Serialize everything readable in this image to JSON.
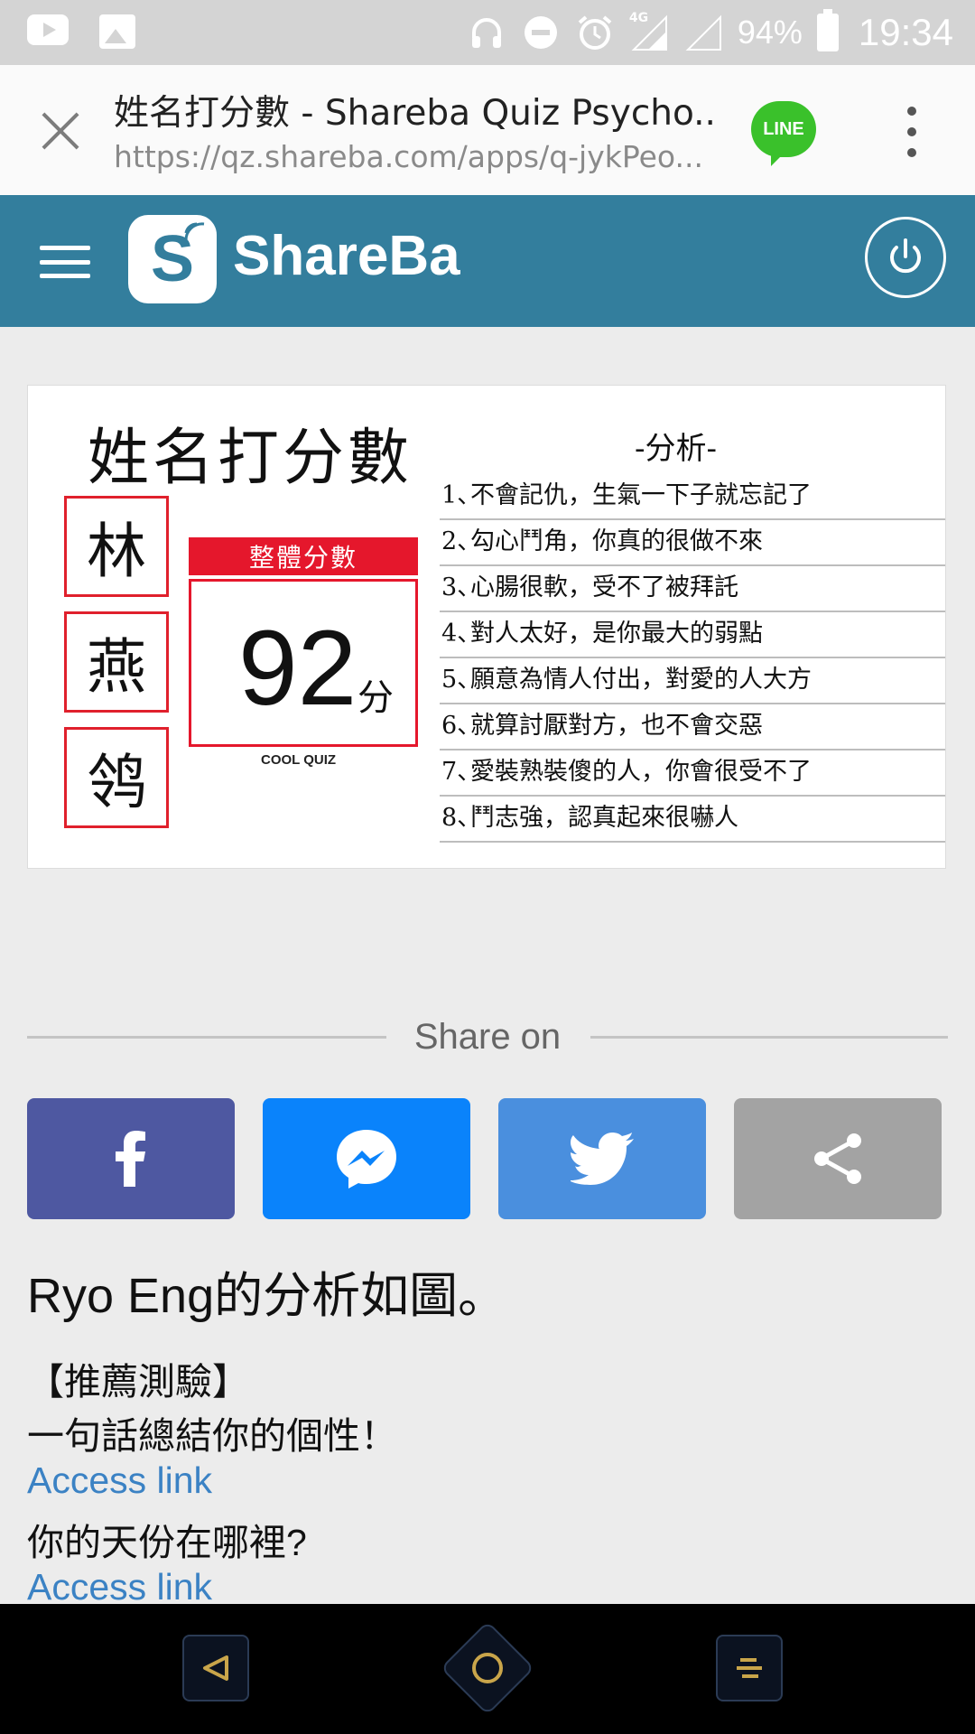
{
  "status_bar": {
    "battery_percent": "94%",
    "time": "19:34",
    "network": "4G",
    "icons": [
      "youtube-icon",
      "gallery-icon",
      "headphones-icon",
      "do-not-disturb-icon",
      "alarm-icon",
      "signal-icon",
      "battery-icon"
    ]
  },
  "browser": {
    "page_title": "姓名打分數 - Shareba Quiz Psycho...",
    "url": "https://qz.shareba.com/apps/q-jykPeo...",
    "line_label": "LINE"
  },
  "app": {
    "logo_letter": "S",
    "brand": "ShareBa"
  },
  "result_card": {
    "title": "姓名打分數",
    "name_chars": [
      "林",
      "燕",
      "鸰"
    ],
    "score_label": "整體分數",
    "score": "92",
    "score_unit": "分",
    "watermark": "COOL QUIZ",
    "analysis_title": "-分析-",
    "analysis": [
      {
        "n": "1、",
        "text": "不會記仇，生氣一下子就忘記了"
      },
      {
        "n": "2、",
        "text": "勾心鬥角，你真的很做不來"
      },
      {
        "n": "3、",
        "text": "心腸很軟，受不了被拜託"
      },
      {
        "n": "4、",
        "text": "對人太好，是你最大的弱點"
      },
      {
        "n": "5、",
        "text": "願意為情人付出，對愛的人大方"
      },
      {
        "n": "6、",
        "text": "就算討厭對方，也不會交惡"
      },
      {
        "n": "7、",
        "text": "愛裝熟裝傻的人，你會很受不了"
      },
      {
        "n": "8、",
        "text": "鬥志強，認真起來很嚇人"
      }
    ]
  },
  "share": {
    "label": "Share on",
    "buttons": [
      {
        "name": "facebook",
        "color": "#4e58a1"
      },
      {
        "name": "messenger",
        "color": "#0a83fb"
      },
      {
        "name": "twitter",
        "color": "#4a8fde"
      },
      {
        "name": "share",
        "color": "#a3a3a3"
      }
    ]
  },
  "content": {
    "headline": "Ryo Eng的分析如圖。",
    "recommend_label": "【推薦測驗】",
    "quiz1": "一句話總結你的個性！",
    "link1": "Access link",
    "quiz2": "你的天份在哪裡?",
    "link2": "Access link"
  },
  "navbar": {
    "accent": "#c9a54a"
  }
}
